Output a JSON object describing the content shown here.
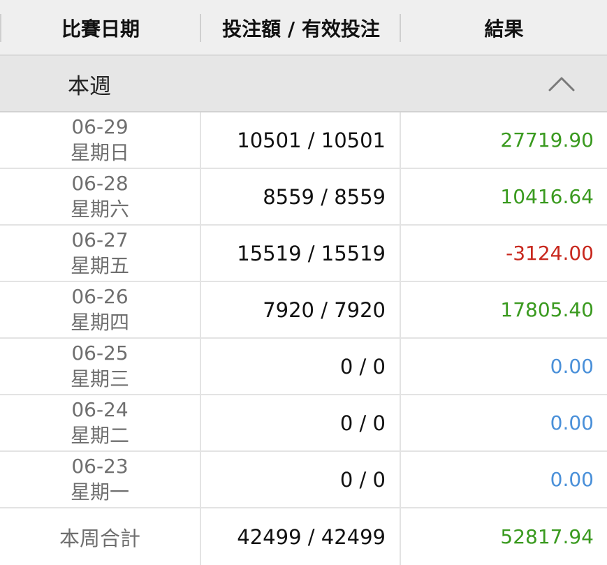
{
  "header": {
    "col_date": "比賽日期",
    "col_bet": "投注額 / 有效投注",
    "col_result": "結果"
  },
  "section": {
    "title": "本週",
    "toggle_icon": "chevron-up-icon"
  },
  "colors": {
    "positive": "#3a9a1f",
    "negative": "#c8281e",
    "zero": "#4a90d9"
  },
  "rows": [
    {
      "date": "06-29",
      "weekday": "星期日",
      "bet": "10501 / 10501",
      "result": "27719.90",
      "status": "positive"
    },
    {
      "date": "06-28",
      "weekday": "星期六",
      "bet": "8559 / 8559",
      "result": "10416.64",
      "status": "positive"
    },
    {
      "date": "06-27",
      "weekday": "星期五",
      "bet": "15519 / 15519",
      "result": "-3124.00",
      "status": "negative"
    },
    {
      "date": "06-26",
      "weekday": "星期四",
      "bet": "7920 / 7920",
      "result": "17805.40",
      "status": "positive"
    },
    {
      "date": "06-25",
      "weekday": "星期三",
      "bet": "0 / 0",
      "result": "0.00",
      "status": "zero"
    },
    {
      "date": "06-24",
      "weekday": "星期二",
      "bet": "0 / 0",
      "result": "0.00",
      "status": "zero"
    },
    {
      "date": "06-23",
      "weekday": "星期一",
      "bet": "0 / 0",
      "result": "0.00",
      "status": "zero"
    }
  ],
  "total": {
    "label": "本周合計",
    "bet": "42499 / 42499",
    "result": "52817.94",
    "status": "positive"
  }
}
